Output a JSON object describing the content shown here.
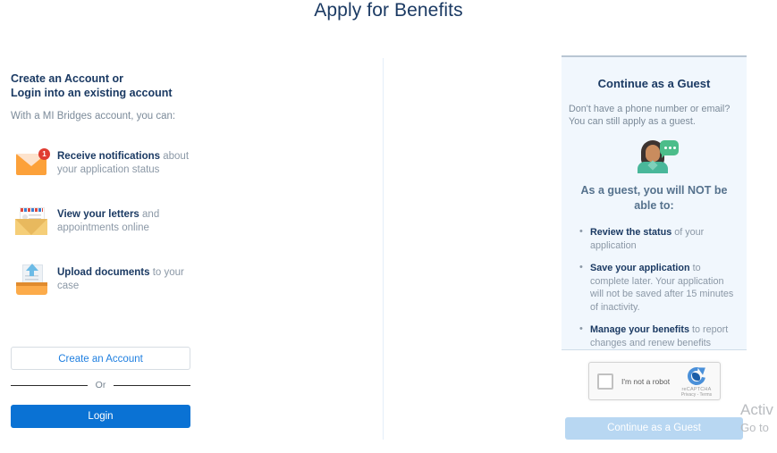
{
  "page": {
    "title": "Apply for Benefits"
  },
  "left": {
    "heading_line1": "Create an Account or",
    "heading_line2": "Login into an existing account",
    "subtitle": "With a MI Bridges account, you can:",
    "features": [
      {
        "icon": "envelope-notification-icon",
        "badge": "1",
        "bold": "Receive notifications",
        "rest": " about your application status"
      },
      {
        "icon": "open-letter-icon",
        "bold": "View your letters",
        "rest": " and appointments online"
      },
      {
        "icon": "upload-documents-icon",
        "bold": "Upload documents",
        "rest": " to your case"
      }
    ],
    "create_account_label": "Create an Account",
    "or_label": "Or",
    "login_label": "Login"
  },
  "guest": {
    "title": "Continue as a Guest",
    "subtitle_line1": "Don't have a phone number or email?",
    "subtitle_line2": "You can still apply as a guest.",
    "avatar_icon": "guest-avatar-icon",
    "not_able_heading": "As a guest, you will NOT be able to:",
    "bullets": [
      {
        "bold": "Review the status",
        "rest": " of your application"
      },
      {
        "bold": "Save your application",
        "rest": " to complete later. Your application will not be saved after 15 minutes of inactivity."
      },
      {
        "bold": "Manage your benefits",
        "rest": " to report changes and renew benefits"
      }
    ],
    "continue_label": "Continue as a Guest"
  },
  "recaptcha": {
    "label": "I'm not a robot",
    "brand": "reCAPTCHA",
    "terms": "Privacy - Terms"
  },
  "watermark": {
    "line1": "Activ",
    "line2": "Go to"
  },
  "colors": {
    "title_navy": "#1b3a63",
    "primary_blue": "#0a72d4",
    "guest_panel_bg": "#f1f7fd",
    "disabled_blue": "#b8d7f2",
    "muted_text": "#8b98a6"
  }
}
